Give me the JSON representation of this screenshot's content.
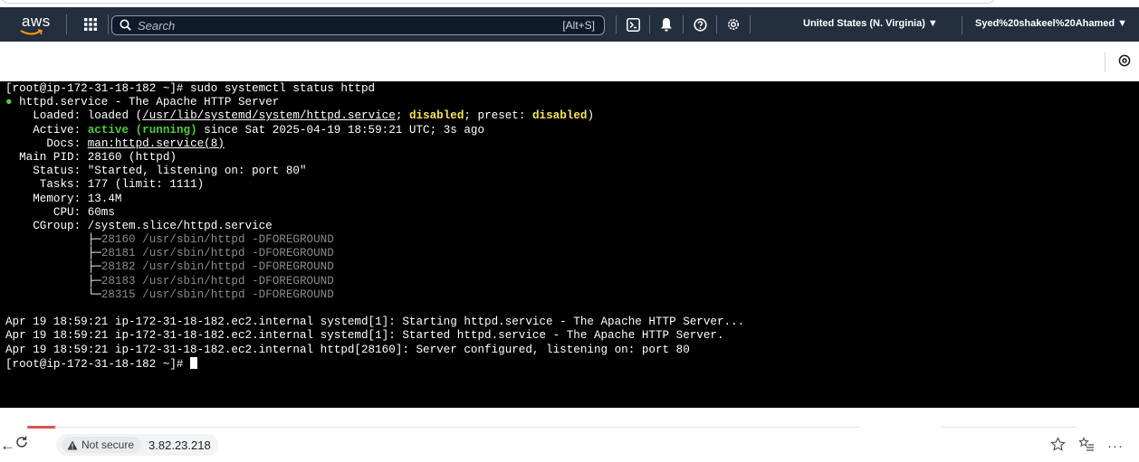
{
  "aws_nav": {
    "logo_text": "aws",
    "search_placeholder": "Search",
    "search_shortcut": "[Alt+S]",
    "region": "United States (N. Virginia) ▼",
    "account": "Syed%20shakeel%20Ahamed ▼",
    "icons": [
      "services-grid-icon",
      "search-icon",
      "cloudshell-icon",
      "bell-icon",
      "help-icon",
      "settings-icon"
    ]
  },
  "toolbar": {
    "icons": [
      "settings-gear-icon"
    ]
  },
  "terminal": {
    "prompt_cmd": "[root@ip-172-31-18-182 ~]# sudo systemctl status httpd",
    "service_bullet": "●",
    "service_line": " httpd.service - The Apache HTTP Server",
    "loaded": {
      "label": "    Loaded: ",
      "pre": "loaded (",
      "path": "/usr/lib/systemd/system/httpd.service",
      "mid": "; ",
      "disabled1": "disabled",
      "mid2": "; preset: ",
      "disabled2": "disabled",
      "end": ")"
    },
    "active": {
      "label": "    Active: ",
      "state": "active (running)",
      "rest": " since Sat 2025-04-19 18:59:21 UTC; 3s ago"
    },
    "docs": {
      "label": "      Docs: ",
      "value": "man:httpd.service(8)"
    },
    "main_pid": "  Main PID: 28160 (httpd)",
    "status": "    Status: \"Started, listening on: port 80\"",
    "tasks": "     Tasks: 177 (limit: 1111)",
    "memory": "    Memory: 13.4M",
    "cpu": "       CPU: 60ms",
    "cgroup": "    CGroup: /system.slice/httpd.service",
    "cgroup_children": [
      {
        "branch": "            ├─",
        "proc": "28160 /usr/sbin/httpd -DFOREGROUND"
      },
      {
        "branch": "            ├─",
        "proc": "28181 /usr/sbin/httpd -DFOREGROUND"
      },
      {
        "branch": "            ├─",
        "proc": "28182 /usr/sbin/httpd -DFOREGROUND"
      },
      {
        "branch": "            ├─",
        "proc": "28183 /usr/sbin/httpd -DFOREGROUND"
      },
      {
        "branch": "            └─",
        "proc": "28315 /usr/sbin/httpd -DFOREGROUND"
      }
    ],
    "log_lines": [
      "Apr 19 18:59:21 ip-172-31-18-182.ec2.internal systemd[1]: Starting httpd.service - The Apache HTTP Server...",
      "Apr 19 18:59:21 ip-172-31-18-182.ec2.internal systemd[1]: Started httpd.service - The Apache HTTP Server.",
      "Apr 19 18:59:21 ip-172-31-18-182.ec2.internal httpd[28160]: Server configured, listening on: port 80"
    ],
    "final_prompt": "[root@ip-172-31-18-182 ~]# "
  },
  "browser": {
    "security_label": "Not secure",
    "url": "3.82.23.218",
    "icons": [
      "back-icon",
      "reload-icon",
      "favorite-star-icon",
      "favorites-list-icon",
      "more-icon",
      "copilot-icon"
    ]
  },
  "colors": {
    "aws_nav_bg": "#232f3e",
    "terminal_bg": "#000000",
    "terminal_green": "#4dcc3c",
    "terminal_yellow": "#f6e356"
  }
}
